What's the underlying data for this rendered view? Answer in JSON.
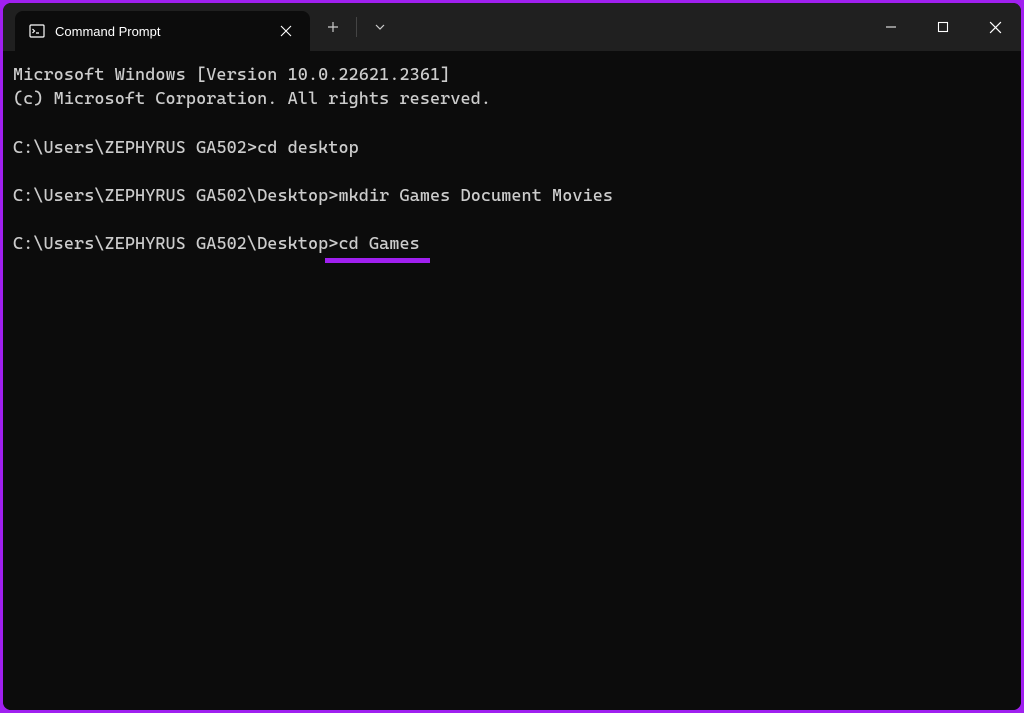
{
  "tab": {
    "title": "Command Prompt"
  },
  "terminal": {
    "header1": "Microsoft Windows [Version 10.0.22621.2361]",
    "header2": "(c) Microsoft Corporation. All rights reserved.",
    "prompt1": "C:\\Users\\ZEPHYRUS GA502>",
    "cmd1": "cd desktop",
    "prompt2": "C:\\Users\\ZEPHYRUS GA502\\Desktop>",
    "cmd2": "mkdir Games Document Movies",
    "prompt3": "C:\\Users\\ZEPHYRUS GA502\\Desktop>",
    "cmd3": "cd Games"
  }
}
